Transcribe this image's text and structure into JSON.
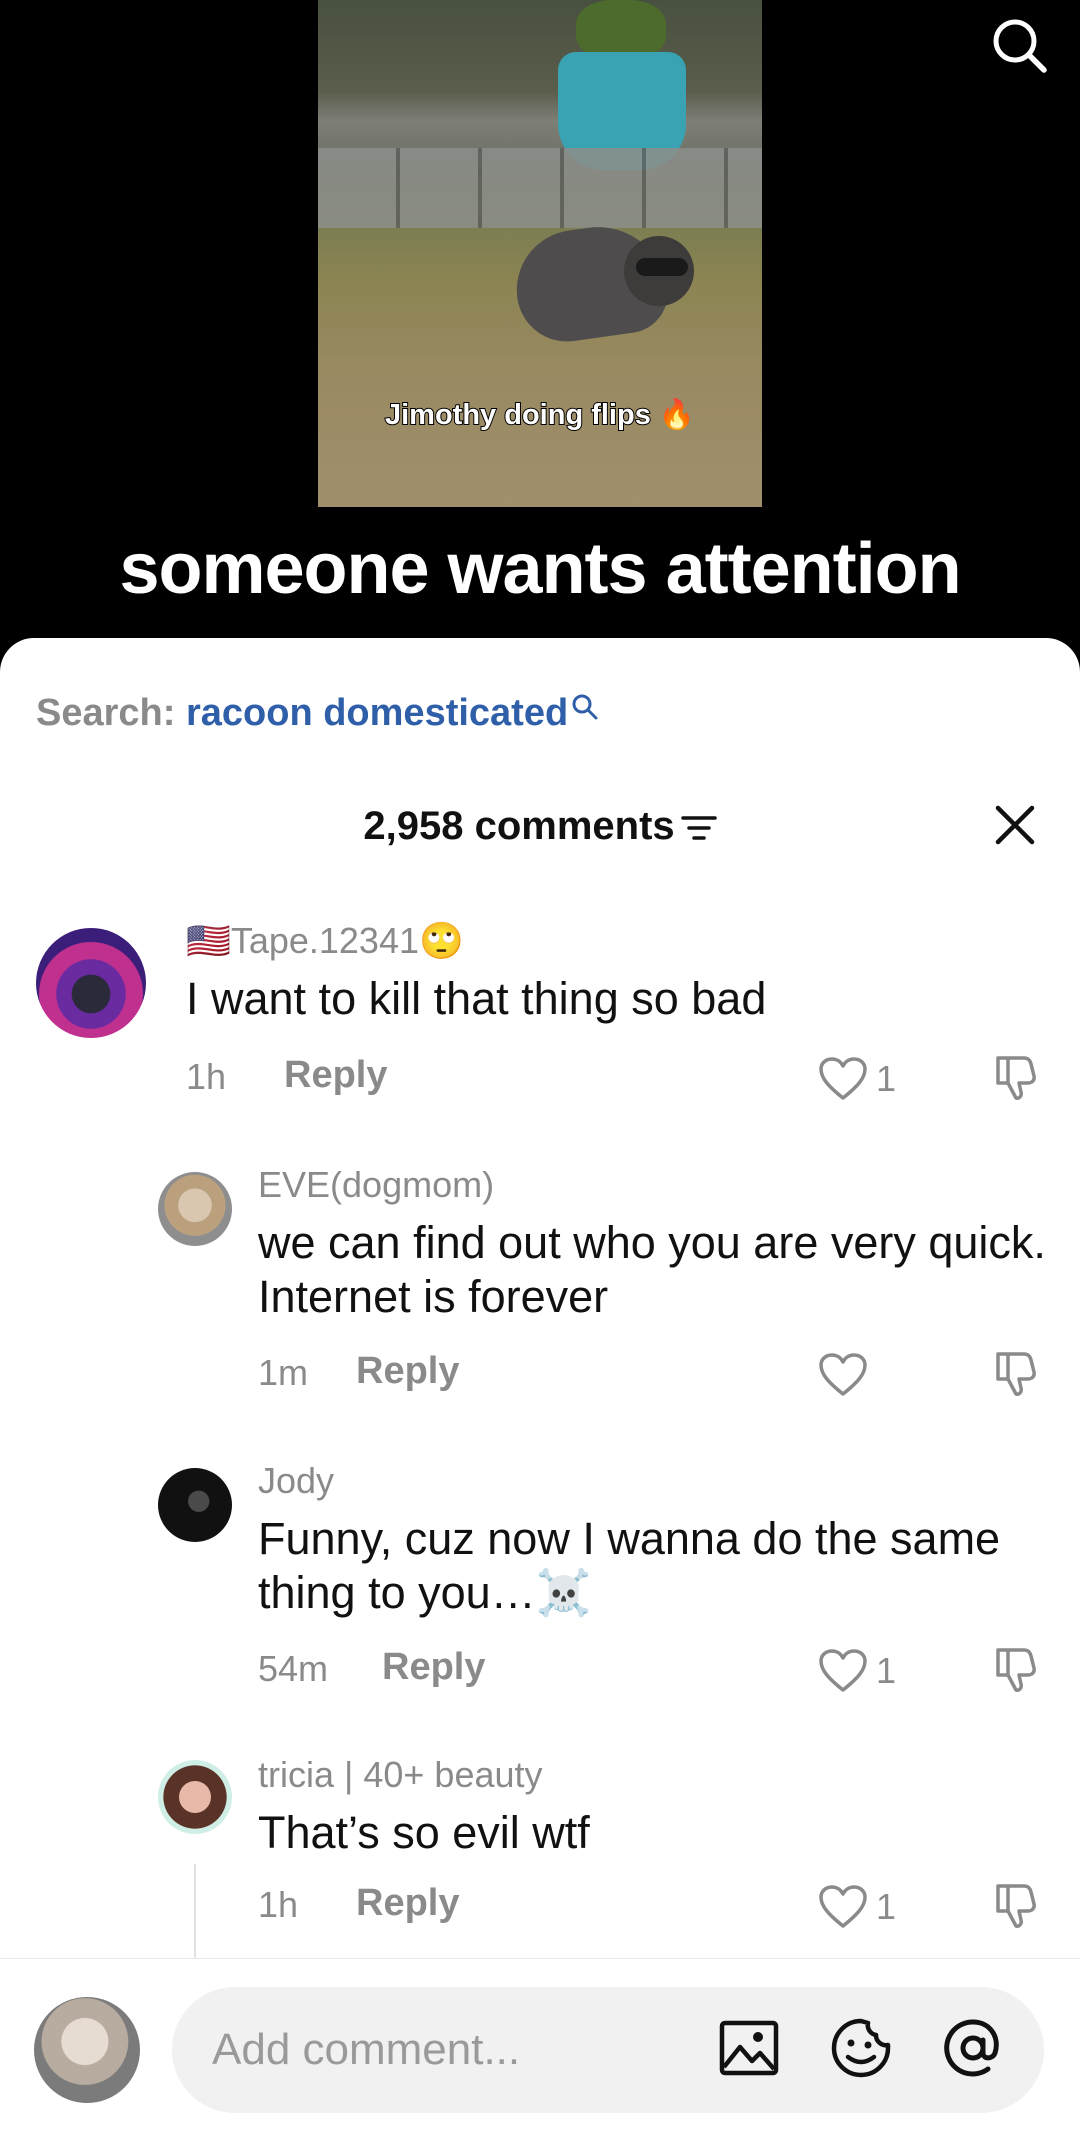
{
  "video": {
    "caption": "Jimothy doing flips 🔥",
    "title": "someone wants attention"
  },
  "search": {
    "label": "Search: ",
    "term": "racoon domesticated"
  },
  "comments_header": {
    "count_label": "2,958 comments"
  },
  "reply_label": "Reply",
  "comments": [
    {
      "username": "🇺🇸Tape.12341🙄",
      "text": "I want to kill that thing so bad",
      "time": "1h",
      "likes": "1"
    },
    {
      "username": "EVE(dogmom)",
      "text": "we can find out who you are very quick. Internet is forever",
      "time": "1m",
      "likes": ""
    },
    {
      "username": "Jody",
      "text": "Funny, cuz now I wanna do the same thing to you…☠️",
      "time": "54m",
      "likes": "1"
    },
    {
      "username": "tricia | 40+ beauty",
      "text": "That’s so evil wtf",
      "time": "1h",
      "likes": "1"
    }
  ],
  "composer": {
    "placeholder": "Add comment..."
  },
  "icons": {
    "search": "search-icon",
    "filter": "filter-icon",
    "close": "close-icon",
    "like": "heart-icon",
    "dislike": "thumbs-down-icon",
    "image": "image-icon",
    "emoji": "emoji-icon",
    "mention": "at-icon"
  },
  "colors": {
    "link_blue": "#2f5fa8",
    "muted_gray": "#8a8a8a",
    "text": "#111111",
    "input_bg": "#f1f1f1"
  }
}
